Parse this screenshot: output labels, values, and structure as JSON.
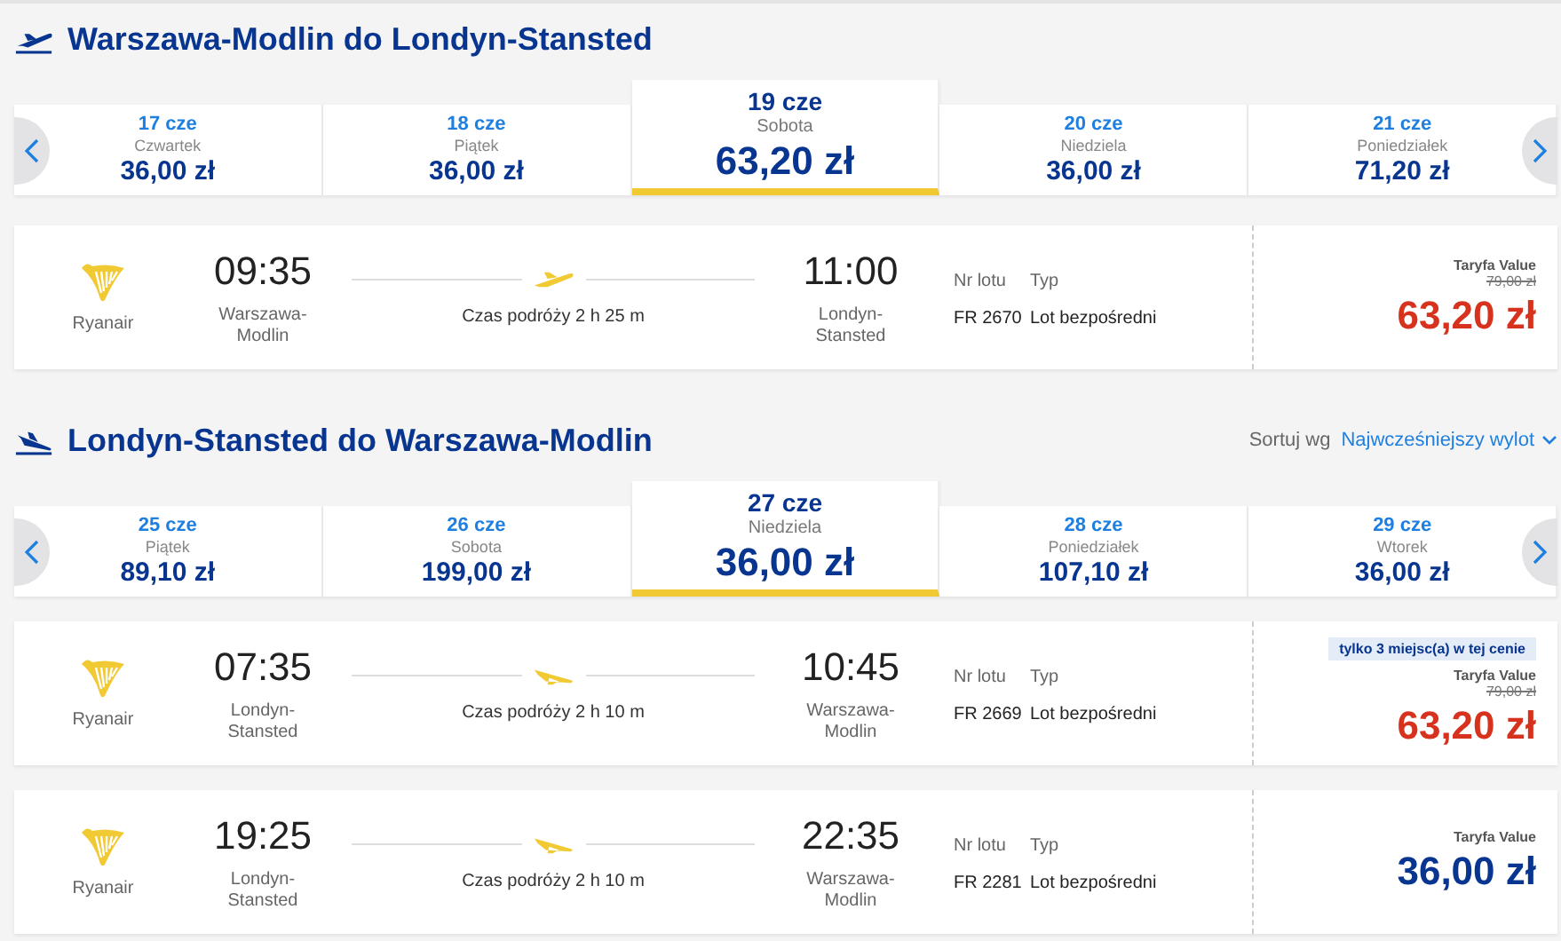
{
  "sections": [
    {
      "kind": "departure",
      "title": "Warszawa-Modlin do Londyn-Stansted",
      "dates": [
        {
          "date": "17 cze",
          "weekday": "Czwartek",
          "price": "36,00 zł",
          "selected": false
        },
        {
          "date": "18 cze",
          "weekday": "Piątek",
          "price": "36,00 zł",
          "selected": false
        },
        {
          "date": "19 cze",
          "weekday": "Sobota",
          "price": "63,20 zł",
          "selected": true
        },
        {
          "date": "20 cze",
          "weekday": "Niedziela",
          "price": "36,00 zł",
          "selected": false
        },
        {
          "date": "21 cze",
          "weekday": "Poniedziałek",
          "price": "71,20 zł",
          "selected": false
        }
      ],
      "flights": [
        {
          "airline": "Ryanair",
          "depart_time": "09:35",
          "depart_airport": "Warszawa-Modlin",
          "duration": "Czas podróży 2 h 25 m",
          "arrive_time": "11:00",
          "arrive_airport": "Londyn-Stansted",
          "flight_no_label": "Nr lotu",
          "flight_no": "FR 2670",
          "type_label": "Typ",
          "type": "Lot bezpośredni",
          "fare": "Taryfa Value",
          "old_price": "79,00 zł",
          "price": "63,20 zł",
          "discounted": true
        }
      ]
    },
    {
      "kind": "arrival",
      "title": "Londyn-Stansted do Warszawa-Modlin",
      "sort_label": "Sortuj wg",
      "sort_value": "Najwcześniejszy wylot",
      "dates": [
        {
          "date": "25 cze",
          "weekday": "Piątek",
          "price": "89,10 zł",
          "selected": false
        },
        {
          "date": "26 cze",
          "weekday": "Sobota",
          "price": "199,00 zł",
          "selected": false
        },
        {
          "date": "27 cze",
          "weekday": "Niedziela",
          "price": "36,00 zł",
          "selected": true
        },
        {
          "date": "28 cze",
          "weekday": "Poniedziałek",
          "price": "107,10 zł",
          "selected": false
        },
        {
          "date": "29 cze",
          "weekday": "Wtorek",
          "price": "36,00 zł",
          "selected": false
        }
      ],
      "flights": [
        {
          "airline": "Ryanair",
          "depart_time": "07:35",
          "depart_airport": "Londyn-Stansted",
          "duration": "Czas podróży 2 h 10 m",
          "arrive_time": "10:45",
          "arrive_airport": "Warszawa-Modlin",
          "flight_no_label": "Nr lotu",
          "flight_no": "FR 2669",
          "type_label": "Typ",
          "type": "Lot bezpośredni",
          "badge": "tylko 3 miejsc(a) w tej cenie",
          "fare": "Taryfa Value",
          "old_price": "79,00 zł",
          "price": "63,20 zł",
          "discounted": true
        },
        {
          "airline": "Ryanair",
          "depart_time": "19:25",
          "depart_airport": "Londyn-Stansted",
          "duration": "Czas podróży 2 h 10 m",
          "arrive_time": "22:35",
          "arrive_airport": "Warszawa-Modlin",
          "flight_no_label": "Nr lotu",
          "flight_no": "FR 2281",
          "type_label": "Typ",
          "type": "Lot bezpośredni",
          "fare": "Taryfa Value",
          "price": "36,00 zł",
          "discounted": false
        }
      ]
    }
  ]
}
